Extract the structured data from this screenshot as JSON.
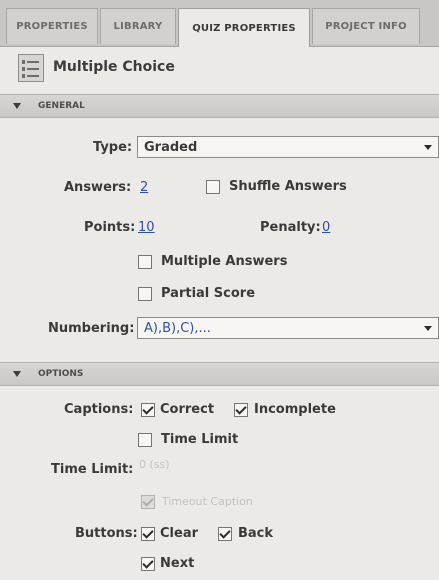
{
  "tabs": [
    {
      "label": "PROPERTIES",
      "active": false
    },
    {
      "label": "LIBRARY",
      "active": false
    },
    {
      "label": "QUIZ PROPERTIES",
      "active": true
    },
    {
      "label": "PROJECT INFO",
      "active": false
    }
  ],
  "title": {
    "icon": "quiz-list-icon",
    "text": "Multiple Choice"
  },
  "general": {
    "header": "GENERAL",
    "type_label": "Type:",
    "type_value": "Graded",
    "answers_label": "Answers:",
    "answers_value": "2",
    "shuffle_label": "Shuffle Answers",
    "shuffle_checked": false,
    "points_label": "Points:",
    "points_value": "10",
    "penalty_label": "Penalty:",
    "penalty_value": "0",
    "multiple_answers_label": "Multiple Answers",
    "multiple_answers_checked": false,
    "partial_score_label": "Partial Score",
    "partial_score_checked": false,
    "numbering_label": "Numbering:",
    "numbering_value": "A),B),C),..."
  },
  "options": {
    "header": "OPTIONS",
    "captions_label": "Captions:",
    "correct_label": "Correct",
    "correct_checked": true,
    "incomplete_label": "Incomplete",
    "incomplete_checked": true,
    "time_limit_checkbox_label": "Time Limit",
    "time_limit_checked": false,
    "time_limit_label": "Time Limit:",
    "time_limit_value": "0 (ss)",
    "timeout_caption_label": "Timeout Caption",
    "timeout_caption_checked": true,
    "buttons_label": "Buttons:",
    "clear_label": "Clear",
    "clear_checked": true,
    "back_label": "Back",
    "back_checked": true,
    "next_label": "Next",
    "next_checked": true
  },
  "colors": {
    "link": "#2c50a8",
    "panel_bg": "#eceae6",
    "header_bg": "#d0ceca"
  }
}
